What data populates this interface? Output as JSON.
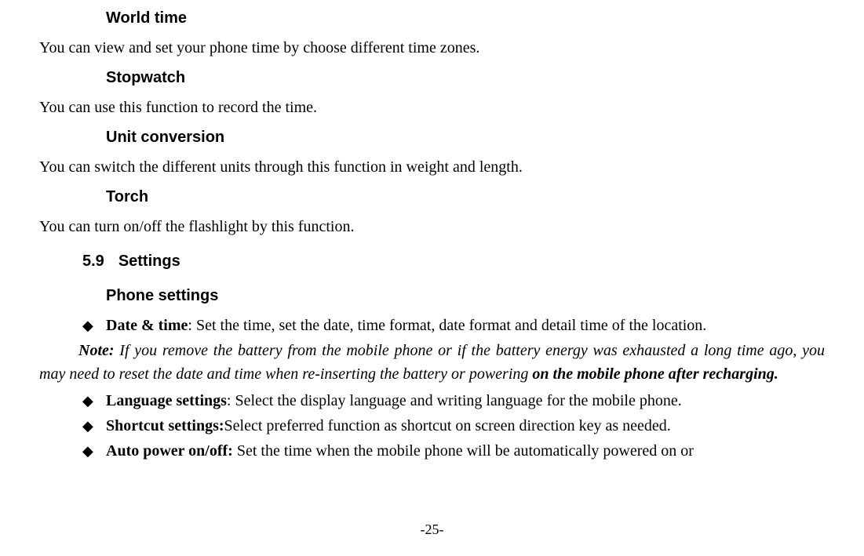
{
  "sections": {
    "worldTime": {
      "title": "World time",
      "body": "You can view and set your phone time by choose different time zones."
    },
    "stopwatch": {
      "title": "Stopwatch",
      "body": "You can use this function to record the time."
    },
    "unitConversion": {
      "title": "Unit conversion",
      "body": "You can switch the different units through this function in weight and length."
    },
    "torch": {
      "title": "Torch",
      "body": "You can turn on/off the flashlight by this function."
    },
    "settings": {
      "number": "5.9",
      "title": "Settings"
    },
    "phoneSettings": {
      "title": "Phone settings"
    }
  },
  "bullets": {
    "dateTime": {
      "label": "Date & time",
      "text": ": Set the time, set the date, time format, date format and detail time of the location."
    },
    "languageSettings": {
      "label": "Language settings",
      "text": ": Select the display language and writing language for the mobile phone."
    },
    "shortcutSettings": {
      "label": "Shortcut settings:",
      "text": "Select preferred function as shortcut on screen direction key as needed."
    },
    "autoPower": {
      "label": "Auto power on/off:",
      "text": " Set the time when the mobile phone will be automatically powered on or"
    }
  },
  "note": {
    "label": "Note:",
    "body": " If you remove the battery from the mobile phone or if the battery energy was exhausted a long time ago, you may need to reset the date and time when re-inserting the battery or powering ",
    "emphasis": "on the mobile phone after recharging."
  },
  "bulletGlyph": "◆",
  "pageNumber": "-25-"
}
